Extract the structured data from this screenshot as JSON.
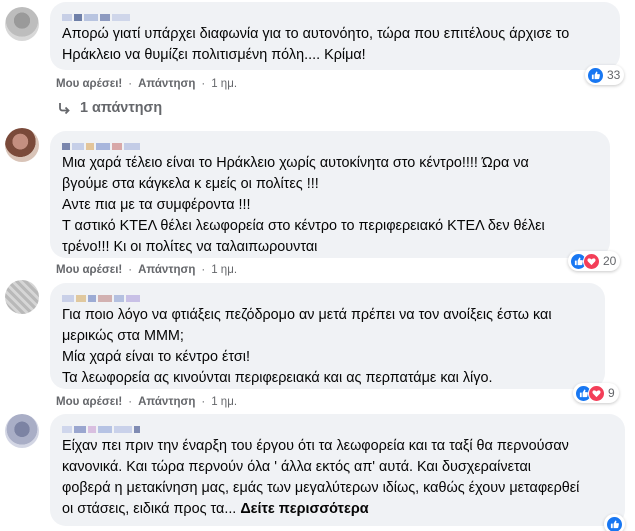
{
  "comments": [
    {
      "text_lines": [
        "Απορώ γιατί υπάρχει διαφωνία για το αυτονόητο, τώρα που επιτέλους άρχισε το",
        "Ηράκλειο να θυμίζει πολιτισμένη πόλη.... Κρίμα!"
      ],
      "like_label": "Μου αρέσει!",
      "reply_label": "Απάντηση",
      "time": "1 ημ.",
      "reactions": {
        "icons": [
          "like-icon"
        ],
        "count": "33"
      },
      "replies_link": "1 απάντηση"
    },
    {
      "text_lines": [
        "Μια χαρά τέλειο είναι το Ηράκλειο χωρίς αυτοκίνητα στο κέντρο!!!! Ώρα να",
        "βγούμε στα κάγκελα κ εμείς οι πολίτες !!!",
        "Αντε πια με τα συμφέροντα !!!",
        "Τ αστικό ΚΤΕΛ θέλει λεωφορεία στο κέντρο το περιφερειακό ΚΤΕΛ δεν θέλει",
        "τρένο!!! Κι οι πολίτες να ταλαιπωρουνται"
      ],
      "like_label": "Μου αρέσει!",
      "reply_label": "Απάντηση",
      "time": "1 ημ.",
      "reactions": {
        "icons": [
          "like-icon",
          "love-icon"
        ],
        "count": "20"
      }
    },
    {
      "text_lines": [
        "Για ποιο λόγο να φτιάξεις πεζόδρομο αν μετά πρέπει να τον ανοίξεις έστω και",
        "μερικώς στα ΜΜΜ;",
        "Μία χαρά είναι το κέντρο έτσι!",
        "Τα λεωφορεία ας κινούνται περιφερειακά και ας περπατάμε και λίγο."
      ],
      "like_label": "Μου αρέσει!",
      "reply_label": "Απάντηση",
      "time": "1 ημ.",
      "reactions": {
        "icons": [
          "like-icon",
          "love-icon"
        ],
        "count": "9"
      }
    },
    {
      "text_lines": [
        "Είχαν πει πριν την έναρξη του έργου ότι τα λεωφορεία και τα ταξί θα περνούσαν",
        "κανονικά. Και τώρα περνούν όλα ' άλλα εκτός απ' αυτά. Και δυσχεραίνεται",
        "φοβερά η μετακίνηση μας, εμάς των μεγαλύτερων ιδίως, καθώς έχουν μεταφερθεί",
        "οι στάσεις, ειδικά προς τα..."
      ],
      "see_more": "Δείτε περισσότερα",
      "reactions": {
        "icons": [
          "like-icon"
        ],
        "count": ""
      }
    }
  ],
  "colors": {
    "bubble": "#f0f2f5",
    "meta_text": "#65676b",
    "like_blue": "#1877f2",
    "love_red": "#f33e58"
  }
}
